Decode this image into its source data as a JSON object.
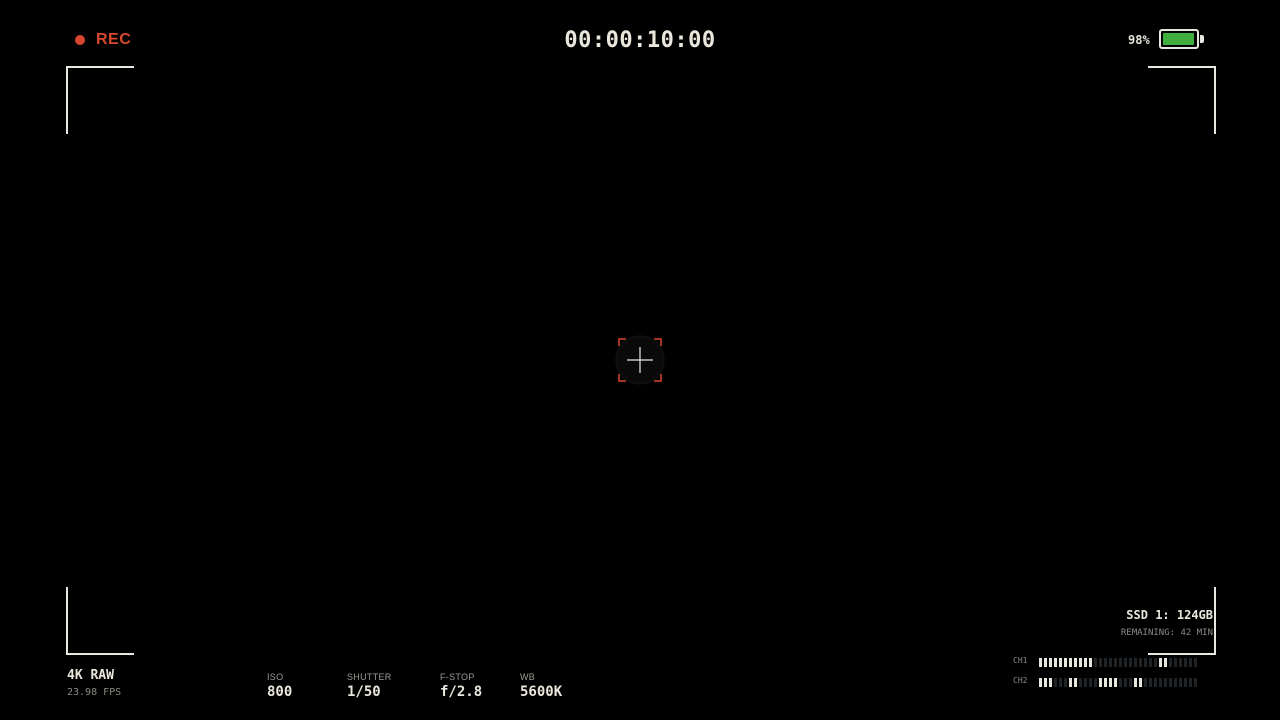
{
  "recording": {
    "label": "REC",
    "color": "#d6472c"
  },
  "timecode": "00:00:10:00",
  "battery": {
    "percent_label": "98%",
    "level": 0.98,
    "fill_color": "#3fae3f"
  },
  "reticle": {
    "color": "#d6472c",
    "icon": "focus-reticle-icon"
  },
  "format": {
    "resolution": "4K RAW",
    "frame_rate": "23.98 FPS"
  },
  "exposure": [
    {
      "label": "ISO",
      "value": "800"
    },
    {
      "label": "SHUTTER",
      "value": "1/50"
    },
    {
      "label": "F-STOP",
      "value": "f/2.8"
    },
    {
      "label": "WB",
      "value": "5600K"
    }
  ],
  "storage": {
    "media": "SSD 1: 124GB",
    "remaining": "REMAINING: 42 MIN"
  },
  "audio": {
    "segment_count": 32,
    "channels": [
      {
        "label": "CH1",
        "active_segments": [
          0,
          1,
          2,
          3,
          4,
          5,
          6,
          7,
          8,
          9,
          10,
          24,
          25
        ]
      },
      {
        "label": "CH2",
        "active_segments": [
          0,
          1,
          2,
          6,
          7,
          12,
          13,
          14,
          15,
          19,
          20
        ]
      }
    ]
  }
}
